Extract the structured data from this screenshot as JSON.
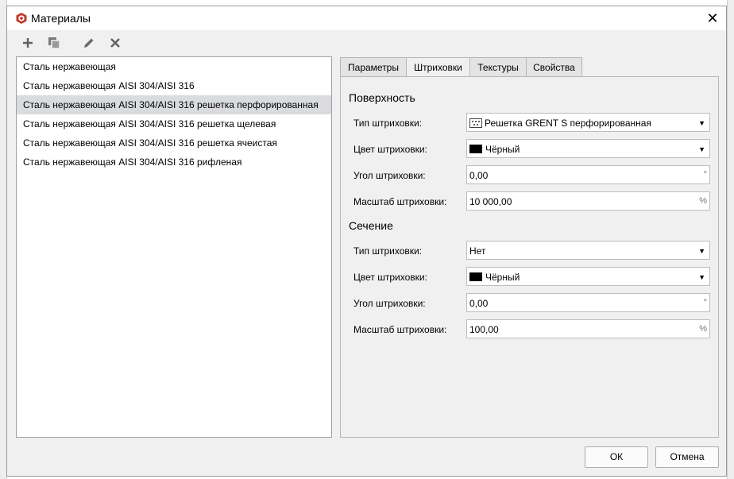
{
  "window": {
    "title": "Материалы",
    "close_glyph": "✕"
  },
  "materials": [
    {
      "label": "Сталь нержавеющая"
    },
    {
      "label": "Сталь нержавеющая AISI 304/AISI 316"
    },
    {
      "label": "Сталь нержавеющая AISI 304/AISI 316 решетка перфорированная",
      "selected": true
    },
    {
      "label": "Сталь нержавеющая AISI 304/AISI 316 решетка щелевая"
    },
    {
      "label": "Сталь нержавеющая AISI 304/AISI 316 решетка ячеистая"
    },
    {
      "label": "Сталь нержавеющая AISI 304/AISI 316 рифленая"
    }
  ],
  "tabs": [
    {
      "label": "Параметры"
    },
    {
      "label": "Штриховки",
      "active": true
    },
    {
      "label": "Текстуры"
    },
    {
      "label": "Свойства"
    }
  ],
  "surface": {
    "heading": "Поверхность",
    "hatch_type_label": "Тип штриховки:",
    "hatch_type_value": "Решетка GRENT S перфорированная",
    "hatch_color_label": "Цвет штриховки:",
    "hatch_color_value": "Чёрный",
    "hatch_angle_label": "Угол штриховки:",
    "hatch_angle_value": "0,00",
    "hatch_angle_unit": "°",
    "hatch_scale_label": "Масштаб штриховки:",
    "hatch_scale_value": "10 000,00",
    "hatch_scale_unit": "%"
  },
  "section": {
    "heading": "Сечение",
    "hatch_type_label": "Тип штриховки:",
    "hatch_type_value": "Нет",
    "hatch_color_label": "Цвет штриховки:",
    "hatch_color_value": "Чёрный",
    "hatch_angle_label": "Угол штриховки:",
    "hatch_angle_value": "0,00",
    "hatch_angle_unit": "°",
    "hatch_scale_label": "Масштаб штриховки:",
    "hatch_scale_value": "100,00",
    "hatch_scale_unit": "%"
  },
  "dropdown_arrow": "▼",
  "buttons": {
    "ok": "ОК",
    "cancel": "Отмена"
  },
  "colors": {
    "selection": "#d9dbde",
    "swatch": "#000000",
    "accent_icon": "#c0392b"
  }
}
